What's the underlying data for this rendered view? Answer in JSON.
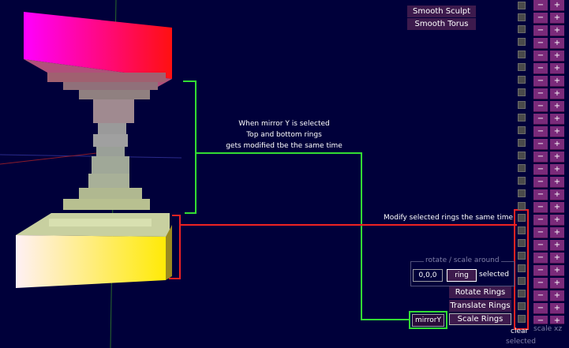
{
  "top_buttons": [
    "Smooth Sculpt",
    "Smooth Torus"
  ],
  "annotations": {
    "mirror_lines": [
      "When mirror Y is selected",
      "Top and bottom rings",
      "gets modified tbe the same time"
    ],
    "modify_line": "Modify selected rings the same time"
  },
  "rotate_panel": {
    "title": "rotate / scale around",
    "pivot_value": "0,0,0",
    "ring_label": "ring",
    "selected_label": "selected"
  },
  "ring_buttons": [
    "Rotate Rings",
    "Translate Rings",
    "Scale Rings"
  ],
  "mirror_label": "mirrorY",
  "clear_label": "clear",
  "selected_caption": "selected",
  "scale_caption": "scale xz",
  "stepper": {
    "minus": "−",
    "plus": "+"
  },
  "colors": {
    "background": "#00003a",
    "button": "#3d1a4d",
    "stepper": "#7a2a7a",
    "green_line": "#33dd33",
    "red_line": "#ee2222"
  }
}
